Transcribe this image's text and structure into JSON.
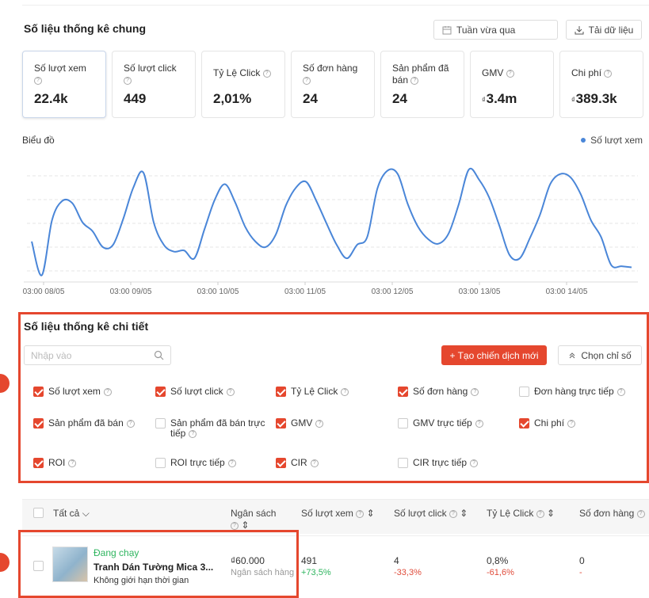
{
  "overview": {
    "title": "Số liệu thống kê chung",
    "period_label": "Tuần vừa qua",
    "download_label": "Tải dữ liệu",
    "cards": [
      {
        "label": "Số lượt xem",
        "value": "22.4k",
        "currency": ""
      },
      {
        "label": "Số lượt click",
        "value": "449",
        "currency": ""
      },
      {
        "label": "Tỷ Lệ Click",
        "value": "2,01%",
        "currency": ""
      },
      {
        "label": "Số đơn hàng",
        "value": "24",
        "currency": ""
      },
      {
        "label": "Sản phẩm đã bán",
        "value": "24",
        "currency": ""
      },
      {
        "label": "GMV",
        "value": "3.4m",
        "currency": "₫"
      },
      {
        "label": "Chi phí",
        "value": "389.3k",
        "currency": "₫"
      }
    ]
  },
  "chart_section": {
    "label": "Biểu đồ",
    "legend": "Số lượt xem",
    "line_color": "#4a86d8"
  },
  "chart_data": {
    "type": "line",
    "x_tick_labels": [
      "03:00 08/05",
      "03:00 09/05",
      "03:00 10/05",
      "03:00 11/05",
      "03:00 12/05",
      "03:00 13/05",
      "03:00 14/05"
    ],
    "series": [
      {
        "name": "Số lượt xem",
        "values": [
          0.36,
          0.06,
          0.55,
          0.72,
          0.7,
          0.53,
          0.45,
          0.31,
          0.33,
          0.56,
          0.84,
          0.97,
          0.53,
          0.33,
          0.27,
          0.28,
          0.21,
          0.47,
          0.73,
          0.87,
          0.71,
          0.49,
          0.36,
          0.31,
          0.42,
          0.68,
          0.84,
          0.89,
          0.72,
          0.52,
          0.33,
          0.21,
          0.33,
          0.4,
          0.83,
          0.99,
          0.96,
          0.69,
          0.49,
          0.38,
          0.34,
          0.43,
          0.69,
          1.0,
          0.91,
          0.75,
          0.5,
          0.24,
          0.21,
          0.39,
          0.6,
          0.87,
          0.96,
          0.93,
          0.78,
          0.55,
          0.4,
          0.15,
          0.14,
          0.13
        ]
      }
    ],
    "y_axis_visible": false,
    "grid": "horizontal dashed"
  },
  "detail": {
    "title": "Số liệu thống kê chi tiết",
    "search_placeholder": "Nhập vào",
    "create_label": "+ Tạo chiến dịch mới",
    "choose_label": "Chọn chỉ số",
    "metrics": [
      {
        "label": "Số lượt xem",
        "checked": true
      },
      {
        "label": "Số lượt click",
        "checked": true
      },
      {
        "label": "Tỷ Lệ Click",
        "checked": true
      },
      {
        "label": "Số đơn hàng",
        "checked": true
      },
      {
        "label": "Đơn hàng trực tiếp",
        "checked": false
      },
      {
        "label": "Sản phẩm đã bán",
        "checked": true
      },
      {
        "label": "Sản phẩm đã bán trực tiếp",
        "checked": false
      },
      {
        "label": "GMV",
        "checked": true
      },
      {
        "label": "GMV trực tiếp",
        "checked": false
      },
      {
        "label": "Chi phí",
        "checked": true
      },
      {
        "label": "ROI",
        "checked": true
      },
      {
        "label": "ROI trực tiếp",
        "checked": false
      },
      {
        "label": "CIR",
        "checked": true
      },
      {
        "label": "CIR trực tiếp",
        "checked": false
      }
    ]
  },
  "table": {
    "headers": {
      "all": "Tất cả",
      "budget": "Ngân sách",
      "views": "Số lượt xem",
      "clicks": "Số lượt click",
      "ctr": "Tỷ Lệ Click",
      "orders": "Số đơn hàng"
    },
    "row": {
      "status": "Đang chạy",
      "name": "Tranh Dán Tường Mica 3...",
      "duration": "Không giới hạn thời gian",
      "budget": "₫60.000",
      "budget_note": "Ngân sách hàng r",
      "views": "491",
      "views_change": "+73,5%",
      "clicks": "4",
      "clicks_change": "-33,3%",
      "ctr": "0,8%",
      "ctr_change": "-61,6%",
      "orders": "0",
      "orders_change": "-"
    }
  },
  "colors": {
    "accent": "#e5472e",
    "line": "#4a86d8",
    "positive": "#2fb55f",
    "negative": "#e04c3b"
  }
}
